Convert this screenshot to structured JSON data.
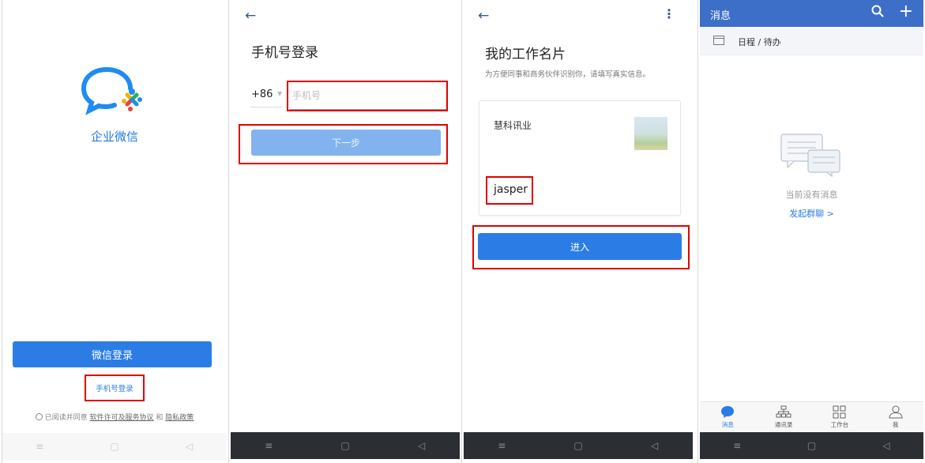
{
  "screen1": {
    "app_name": "企业微信",
    "wechat_login_label": "微信登录",
    "phone_login_label": "手机号登录",
    "agree_prefix": "已阅读并同意",
    "agree_link1": "软件许可及服务协议",
    "agree_and": "和",
    "agree_link2": "隐私政策"
  },
  "screen2": {
    "back_icon": "←",
    "title": "手机号登录",
    "country_code": "+86",
    "phone_placeholder": "手机号",
    "next_label": "下一步"
  },
  "screen3": {
    "back_icon": "←",
    "more_icon": "⋮",
    "title": "我的工作名片",
    "subtitle": "为方便同事和商务伙伴识别你，请填写真实信息。",
    "company": "慧科讯业",
    "name": "jasper",
    "enter_label": "进入"
  },
  "screen4": {
    "title": "消息",
    "search_icon": "⚲",
    "add_icon": "+",
    "schedule_label": "日程 / 待办",
    "empty_text": "当前没有消息",
    "start_chat_label": "发起群聊 >",
    "tabs": [
      {
        "label": "消息",
        "icon": "●",
        "active": true
      },
      {
        "label": "通讯录",
        "icon": "品",
        "active": false
      },
      {
        "label": "工作台",
        "icon": "▦",
        "active": false
      },
      {
        "label": "我",
        "icon": "♙",
        "active": false
      }
    ]
  },
  "navbar": {
    "menu": "≡",
    "home": "▢",
    "back": "◁"
  },
  "colors": {
    "brand_blue": "#2b7de5",
    "disabled_blue": "#82b3ee",
    "header_blue": "#3d6fc9",
    "highlight_red": "#e00000"
  }
}
